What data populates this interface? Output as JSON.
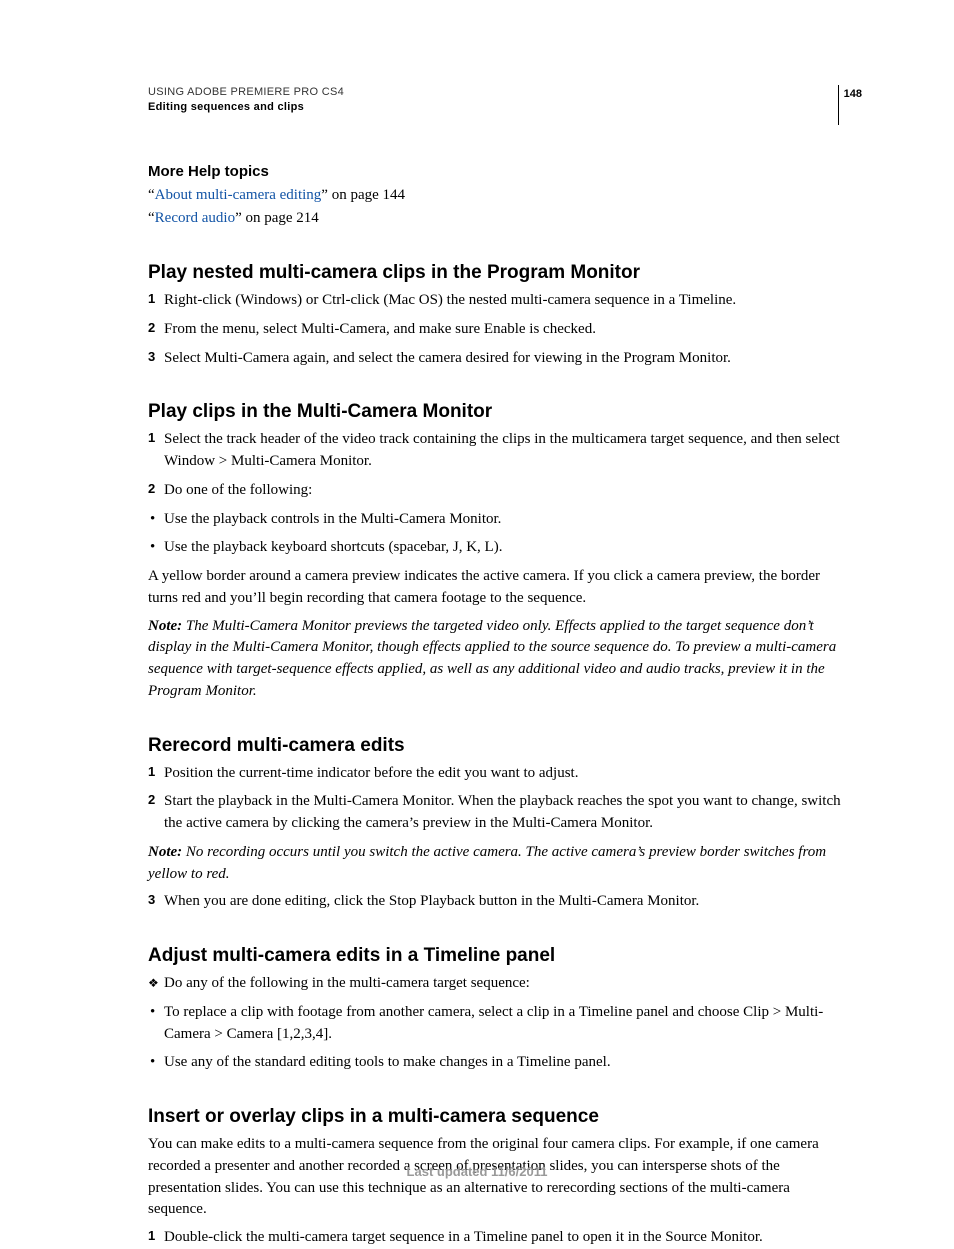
{
  "header": {
    "line1": "USING ADOBE PREMIERE PRO CS4",
    "line2": "Editing sequences and clips",
    "page_number": "148"
  },
  "more_help": {
    "title": "More Help topics",
    "items": [
      {
        "q1": "“",
        "link": "About multi-camera editing",
        "rest": "” on page 144"
      },
      {
        "q1": "“",
        "link": "Record audio",
        "rest": "” on page 214"
      }
    ]
  },
  "sections": {
    "s1": {
      "title": "Play nested multi-camera clips in the Program Monitor",
      "steps": [
        "Right-click (Windows) or Ctrl-click (Mac OS) the nested multi-camera sequence in a Timeline.",
        "From the menu, select Multi-Camera, and make sure Enable is checked.",
        "Select Multi-Camera again, and select the camera desired for viewing in the Program Monitor."
      ]
    },
    "s2": {
      "title": "Play clips in the Multi-Camera Monitor",
      "step1": "Select the track header of the video track containing the clips in the multicamera target sequence, and then select Window > Multi-Camera Monitor.",
      "step2": "Do one of the following:",
      "bullets": [
        "Use the playback controls in the Multi-Camera Monitor.",
        "Use the playback keyboard shortcuts (spacebar, J, K, L)."
      ],
      "para_after": "A yellow border around a camera preview indicates the active camera. If you click a camera preview, the border turns red and you’ll begin recording that camera footage to the sequence.",
      "note_label": "Note:",
      "note_body": " The Multi-Camera Monitor previews the targeted video only. Effects applied to the target sequence don’t display in the Multi-Camera Monitor, though effects applied to the source sequence do. To preview a multi-camera sequence with target-sequence effects applied, as well as any additional video and audio tracks, preview it in the Program Monitor."
    },
    "s3": {
      "title": "Rerecord multi-camera edits",
      "step1": "Position the current-time indicator before the edit you want to adjust.",
      "step2": "Start the playback in the Multi-Camera Monitor. When the playback reaches the spot you want to change, switch the active camera by clicking the camera’s preview in the Multi-Camera Monitor.",
      "note_label": "Note:",
      "note_body": " No recording occurs until you switch the active camera. The active camera’s preview border switches from yellow to red.",
      "step3": "When you are done editing, click the Stop Playback button in the Multi-Camera Monitor."
    },
    "s4": {
      "title": "Adjust multi-camera edits in a Timeline panel",
      "diamond": "Do any of the following in the multi-camera target sequence:",
      "bullets": [
        "To replace a clip with footage from another camera, select a clip in a Timeline panel and choose Clip > Multi-Camera > Camera [1,2,3,4].",
        "Use any of the standard editing tools to make changes in a Timeline panel."
      ]
    },
    "s5": {
      "title": "Insert or overlay clips in a multi-camera sequence",
      "para": "You can make edits to a multi-camera sequence from the original four camera clips. For example, if one camera recorded a presenter and another recorded a screen of presentation slides, you can intersperse shots of the presentation slides. You can use this technique as an alternative to rerecording sections of the multi-camera sequence.",
      "step1": "Double-click the multi-camera target sequence in a Timeline panel to open it in the Source Monitor."
    }
  },
  "footer": "Last updated 11/6/2011"
}
